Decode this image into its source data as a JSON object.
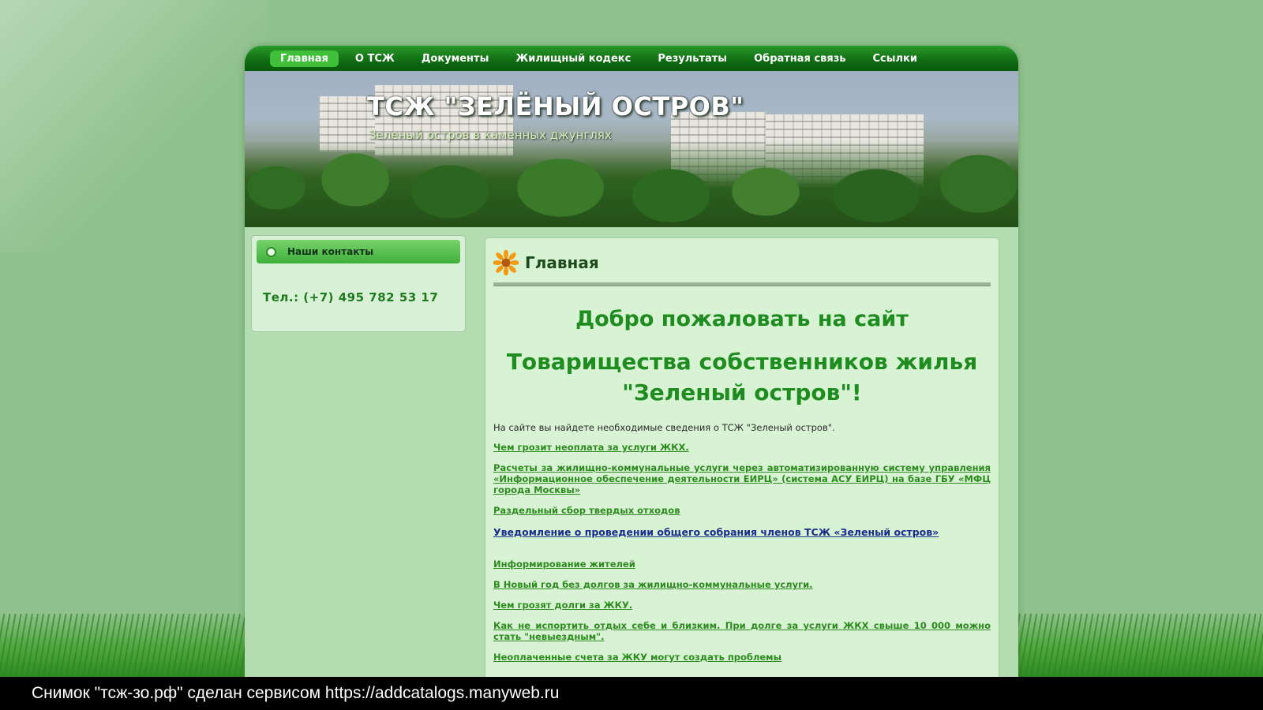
{
  "nav": {
    "items": [
      {
        "label": "Главная",
        "active": true
      },
      {
        "label": "О ТСЖ",
        "active": false
      },
      {
        "label": "Документы",
        "active": false
      },
      {
        "label": "Жилищный кодекс",
        "active": false
      },
      {
        "label": "Результаты",
        "active": false
      },
      {
        "label": "Обратная связь",
        "active": false
      },
      {
        "label": "Ссылки",
        "active": false
      }
    ]
  },
  "banner": {
    "title": "ТСЖ \"ЗЕЛЁНЫЙ ОСТРОВ\"",
    "slogan": "Зеленый остров в каменных джунглях"
  },
  "sidebar": {
    "title": "Наши контакты",
    "phone": "Тел.: (+7) 495 782 53 17"
  },
  "content": {
    "icon": "flower-icon",
    "title": "Главная",
    "welcome": "Добро пожаловать на сайт",
    "company": "Товарищества собственников жилья \"Зеленый остров\"!",
    "intro": "На сайте вы найдете необходимые сведения о ТСЖ \"Зеленый остров\".",
    "links": [
      "Чем грозит неоплата за услуги ЖКХ.",
      "Расчеты за жилищно-коммунальные услуги через автоматизированную систему управления «Информационное обеспечение деятельности ЕИРЦ» (система АСУ ЕИРЦ) на базе ГБУ «МФЦ города Москвы»",
      "Раздельный сбор твердых отходов",
      "Уведомление о проведении общего собрания членов ТСЖ «Зеленый остров»",
      "Информирование жителей",
      "В Новый год без долгов за жилищно-коммунальные услуги.",
      "Чем грозят долги за ЖКУ.",
      "Как не испортить отдых себе и близким. При долге за услуги ЖКХ свыше 10 000 можно стать \"невыездным\".",
      "Неоплаченные счета за ЖКУ могут создать проблемы"
    ]
  },
  "footer": {
    "caption": "Снимок \"тсж-зо.рф\" сделан сервисом https://addcatalogs.manyweb.ru"
  },
  "colors": {
    "background": "#8fc18d",
    "nav_green": "#0f6b12",
    "heading_green": "#1e8c1e",
    "link_green": "#2d8a1f",
    "link_blue": "#1a2c8c"
  }
}
